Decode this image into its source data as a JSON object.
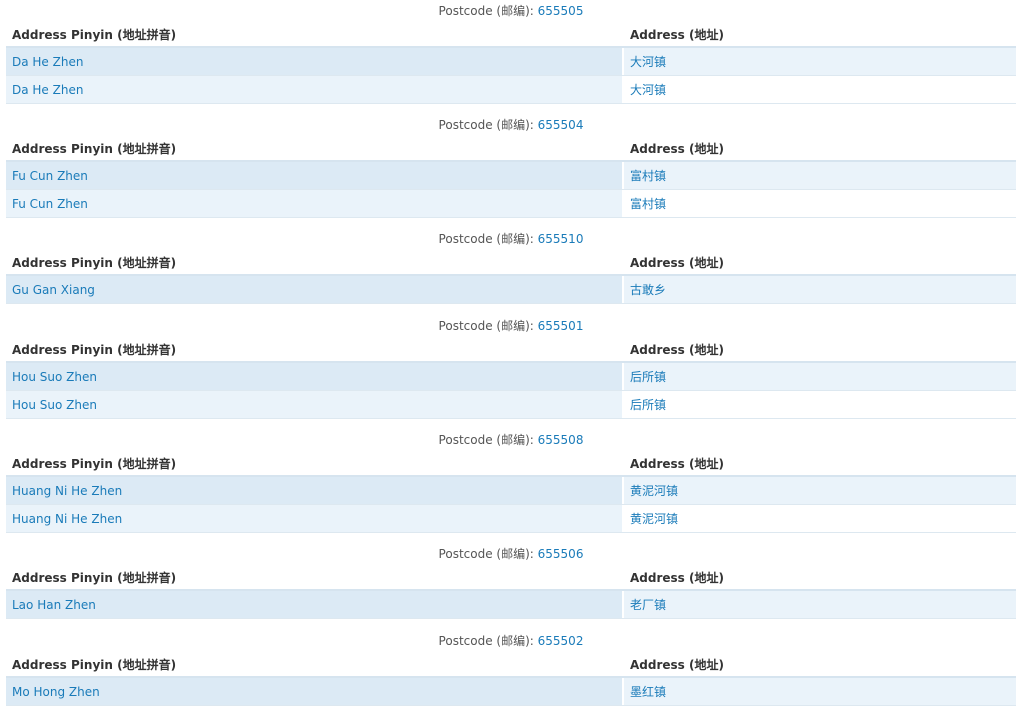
{
  "labels": {
    "postcode_prefix": "Postcode (邮编): ",
    "col_pinyin": "Address Pinyin (地址拼音)",
    "col_address": "Address (地址)"
  },
  "colors": {
    "link": "#1a7bb9",
    "row_dark": "#dceaf5",
    "row_light": "#eaf3fa"
  },
  "groups": [
    {
      "postcode": "655505",
      "rows": [
        {
          "pinyin": "Da He Zhen",
          "address": "大河镇"
        },
        {
          "pinyin": "Da He Zhen",
          "address": "大河镇"
        }
      ]
    },
    {
      "postcode": "655504",
      "rows": [
        {
          "pinyin": "Fu Cun Zhen",
          "address": "富村镇"
        },
        {
          "pinyin": "Fu Cun Zhen",
          "address": "富村镇"
        }
      ]
    },
    {
      "postcode": "655510",
      "rows": [
        {
          "pinyin": "Gu Gan Xiang",
          "address": "古敢乡"
        }
      ]
    },
    {
      "postcode": "655501",
      "rows": [
        {
          "pinyin": "Hou Suo Zhen",
          "address": "后所镇"
        },
        {
          "pinyin": "Hou Suo Zhen",
          "address": "后所镇"
        }
      ]
    },
    {
      "postcode": "655508",
      "rows": [
        {
          "pinyin": "Huang Ni He Zhen",
          "address": "黄泥河镇"
        },
        {
          "pinyin": "Huang Ni He Zhen",
          "address": "黄泥河镇"
        }
      ]
    },
    {
      "postcode": "655506",
      "rows": [
        {
          "pinyin": "Lao Han Zhen",
          "address": "老厂镇"
        }
      ]
    },
    {
      "postcode": "655502",
      "rows": [
        {
          "pinyin": "Mo Hong Zhen",
          "address": "墨红镇"
        }
      ]
    }
  ]
}
